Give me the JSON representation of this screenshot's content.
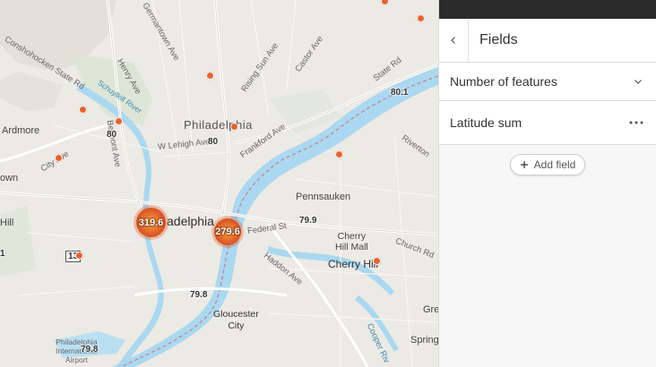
{
  "map": {
    "labels": {
      "germantown_ave": "Germantown Ave",
      "henry_ave": "Henry Ave",
      "rising_sun_ave": "Rising Sun Ave",
      "castor_ave": "Castor Ave",
      "conshohocken_state_rd": "Conshohocken State Rd",
      "schuylkill_river": "Schuylkill River",
      "state_rd": "State Rd",
      "ardmore": "Ardmore",
      "philadelphia_region": "Philadelphia",
      "w_lehigh_ave": "W Lehigh Ave",
      "frankford_ave": "Frankford Ave",
      "city_ave": "City Ave",
      "belmont_ave": "Belmont Ave",
      "own_fragment": "own",
      "riverton": "Riverton",
      "pennsauken": "Pennsauken",
      "hill_fragment": "Hill",
      "philadelphia_city": "adelphia",
      "federal_st": "Federal St",
      "cherry_hill_mall": "Cherry\nHill Mall",
      "church_rd": "Church Rd",
      "cherry_hill": "Cherry Hill",
      "haddon_ave": "Haddon Ave",
      "gloucester_city": "Gloucester\nCity",
      "airport": "Philadelphia\nInternational\nAirport",
      "cooper_river": "Cooper Riv",
      "gre_fragment": "Gre",
      "spring_fragment": "Spring"
    },
    "shields": {
      "s80a": "80",
      "s80b": "80",
      "s80c": "80.1",
      "s799a": "79.9",
      "s798a": "79.8",
      "s798b": "79.8",
      "s13": "13",
      "s1": "1"
    },
    "clusters": [
      {
        "value": "319.6"
      },
      {
        "value": "279.6"
      }
    ],
    "poi_color": "#e8622c",
    "water_color": "#a9d8f0"
  },
  "panel": {
    "title": "Fields",
    "rows": [
      {
        "label": "Number of features"
      },
      {
        "label": "Latitude sum"
      }
    ],
    "add_field_label": "Add field"
  }
}
